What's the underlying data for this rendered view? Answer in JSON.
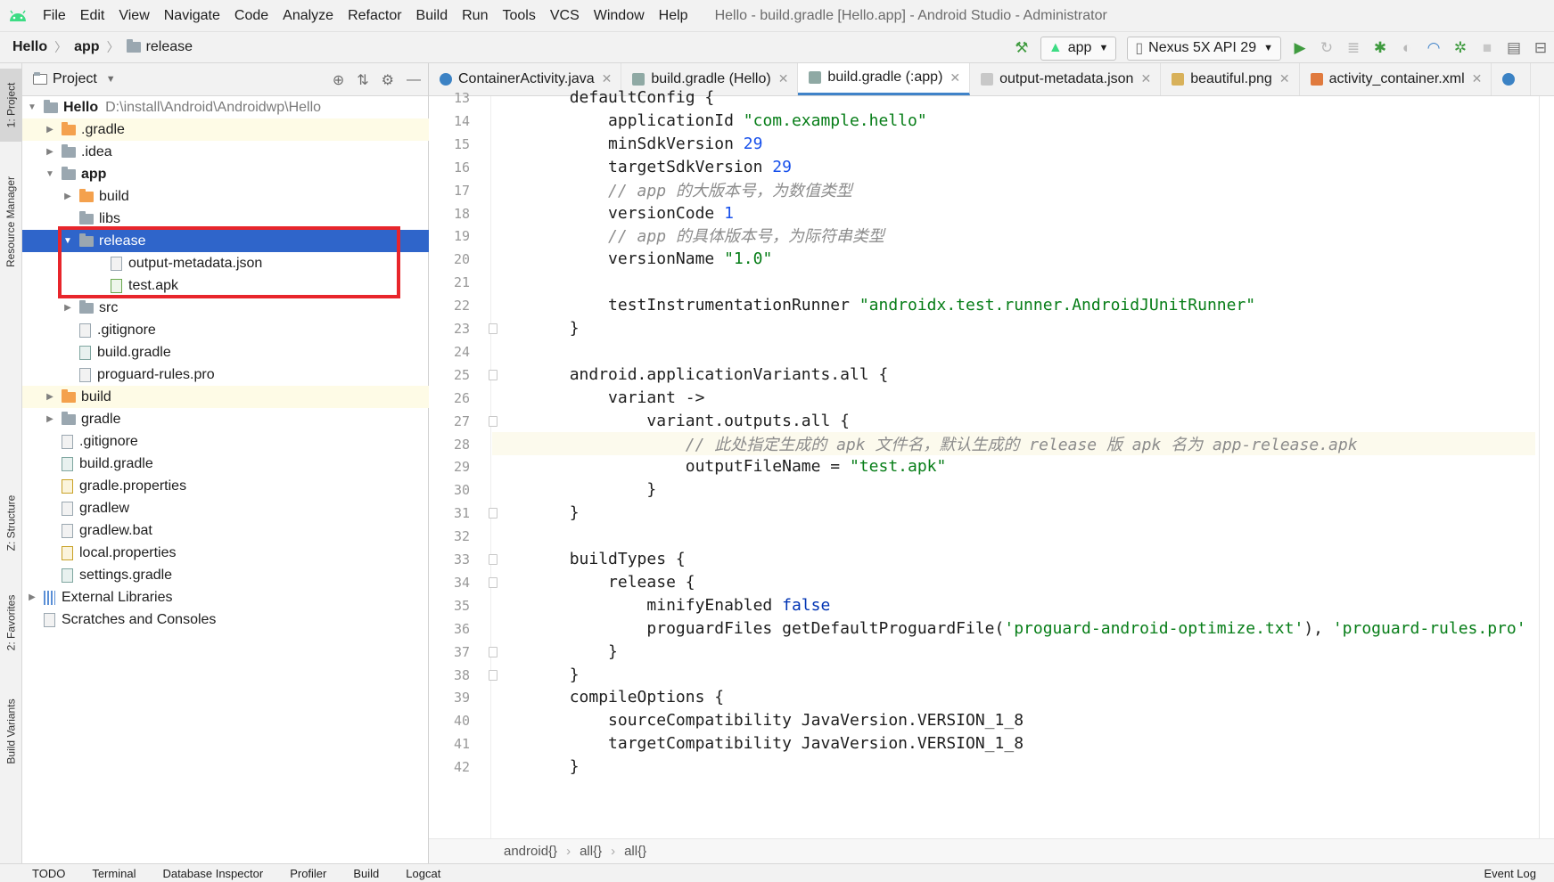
{
  "menubar": {
    "items": [
      "File",
      "Edit",
      "View",
      "Navigate",
      "Code",
      "Analyze",
      "Refactor",
      "Build",
      "Run",
      "Tools",
      "VCS",
      "Window",
      "Help"
    ],
    "window_title": "Hello - build.gradle [Hello.app] - Android Studio - Administrator"
  },
  "navbar": {
    "crumbs": [
      "Hello",
      "app",
      "release"
    ],
    "run_config": "app",
    "device": "Nexus 5X API 29"
  },
  "left_strip": {
    "tabs": [
      "1: Project",
      "Resource Manager",
      "Z: Structure",
      "2: Favorites",
      "Build Variants"
    ]
  },
  "project_panel": {
    "title": "Project",
    "tree": [
      {
        "label": "Hello",
        "path": "D:\\install\\Android\\Androidwp\\Hello"
      },
      {
        "label": ".gradle"
      },
      {
        "label": ".idea"
      },
      {
        "label": "app"
      },
      {
        "label": "build"
      },
      {
        "label": "libs"
      },
      {
        "label": "release"
      },
      {
        "label": "output-metadata.json"
      },
      {
        "label": "test.apk"
      },
      {
        "label": "src"
      },
      {
        "label": ".gitignore"
      },
      {
        "label": "build.gradle"
      },
      {
        "label": "proguard-rules.pro"
      },
      {
        "label": "build"
      },
      {
        "label": "gradle"
      },
      {
        "label": ".gitignore"
      },
      {
        "label": "build.gradle"
      },
      {
        "label": "gradle.properties"
      },
      {
        "label": "gradlew"
      },
      {
        "label": "gradlew.bat"
      },
      {
        "label": "local.properties"
      },
      {
        "label": "settings.gradle"
      },
      {
        "label": "External Libraries"
      },
      {
        "label": "Scratches and Consoles"
      }
    ]
  },
  "editor": {
    "tabs": [
      "ContainerActivity.java",
      "build.gradle (Hello)",
      "build.gradle (:app)",
      "output-metadata.json",
      "beautiful.png",
      "activity_container.xml"
    ],
    "lines": [
      {
        "n": "13",
        "parts": [
          [
            "        defaultConfig {",
            ""
          ]
        ]
      },
      {
        "n": "14",
        "parts": [
          [
            "            applicationId ",
            ""
          ],
          [
            "\"com.example.hello\"",
            "c-str"
          ]
        ]
      },
      {
        "n": "15",
        "parts": [
          [
            "            minSdkVersion ",
            ""
          ],
          [
            "29",
            "c-num"
          ]
        ]
      },
      {
        "n": "16",
        "parts": [
          [
            "            targetSdkVersion ",
            ""
          ],
          [
            "29",
            "c-num"
          ]
        ]
      },
      {
        "n": "17",
        "parts": [
          [
            "            // app 的大版本号，为数值类型",
            "c-cmt"
          ]
        ]
      },
      {
        "n": "18",
        "parts": [
          [
            "            versionCode ",
            ""
          ],
          [
            "1",
            "c-num"
          ]
        ]
      },
      {
        "n": "19",
        "parts": [
          [
            "            // app 的具体版本号，为际符串类型",
            "c-cmt"
          ]
        ]
      },
      {
        "n": "20",
        "parts": [
          [
            "            versionName ",
            ""
          ],
          [
            "\"1.0\"",
            "c-str"
          ]
        ]
      },
      {
        "n": "21",
        "parts": [
          [
            "",
            ""
          ]
        ]
      },
      {
        "n": "22",
        "parts": [
          [
            "            testInstrumentationRunner ",
            ""
          ],
          [
            "\"androidx.test.runner.AndroidJUnitRunner\"",
            "c-str"
          ]
        ]
      },
      {
        "n": "23",
        "parts": [
          [
            "        }",
            ""
          ]
        ]
      },
      {
        "n": "24",
        "parts": [
          [
            "",
            ""
          ]
        ]
      },
      {
        "n": "25",
        "parts": [
          [
            "        android.applicationVariants.all {",
            ""
          ]
        ]
      },
      {
        "n": "26",
        "parts": [
          [
            "            variant ->",
            ""
          ]
        ]
      },
      {
        "n": "27",
        "parts": [
          [
            "                variant.outputs.all {",
            ""
          ]
        ]
      },
      {
        "n": "28",
        "parts": [
          [
            "                    // 此处指定生成的 apk 文件名，默认生成的 release 版 apk 名为 app-release.apk",
            "c-cmt"
          ]
        ]
      },
      {
        "n": "29",
        "parts": [
          [
            "                    outputFileName = ",
            ""
          ],
          [
            "\"test.apk\"",
            "c-str"
          ]
        ]
      },
      {
        "n": "30",
        "parts": [
          [
            "                }",
            ""
          ]
        ]
      },
      {
        "n": "31",
        "parts": [
          [
            "        }",
            ""
          ]
        ]
      },
      {
        "n": "32",
        "parts": [
          [
            "",
            ""
          ]
        ]
      },
      {
        "n": "33",
        "parts": [
          [
            "        buildTypes {",
            ""
          ]
        ]
      },
      {
        "n": "34",
        "parts": [
          [
            "            release {",
            ""
          ]
        ]
      },
      {
        "n": "35",
        "parts": [
          [
            "                minifyEnabled ",
            ""
          ],
          [
            "false",
            "c-kw"
          ]
        ]
      },
      {
        "n": "36",
        "parts": [
          [
            "                proguardFiles getDefaultProguardFile(",
            ""
          ],
          [
            "'proguard-android-optimize.txt'",
            "c-str"
          ],
          [
            "), ",
            ""
          ],
          [
            "'proguard-rules.pro'",
            "c-str"
          ]
        ]
      },
      {
        "n": "37",
        "parts": [
          [
            "            }",
            ""
          ]
        ]
      },
      {
        "n": "38",
        "parts": [
          [
            "        }",
            ""
          ]
        ]
      },
      {
        "n": "39",
        "parts": [
          [
            "        compileOptions {",
            ""
          ]
        ]
      },
      {
        "n": "40",
        "parts": [
          [
            "            sourceCompatibility JavaVersion.VERSION_1_8",
            ""
          ]
        ]
      },
      {
        "n": "41",
        "parts": [
          [
            "            targetCompatibility JavaVersion.VERSION_1_8",
            ""
          ]
        ]
      },
      {
        "n": "42",
        "parts": [
          [
            "        }",
            ""
          ]
        ]
      }
    ],
    "breadcrumb": [
      "android{}",
      "all{}",
      "all{}"
    ]
  },
  "bottom_bar": {
    "items": [
      "TODO",
      "Terminal",
      "Database Inspector",
      "Profiler",
      "Build",
      "Logcat",
      "Event Log"
    ]
  },
  "colors": {
    "selection": "#2f65ca",
    "annotation_box": "#e8252b",
    "highlight_row": "#fefbe6"
  }
}
